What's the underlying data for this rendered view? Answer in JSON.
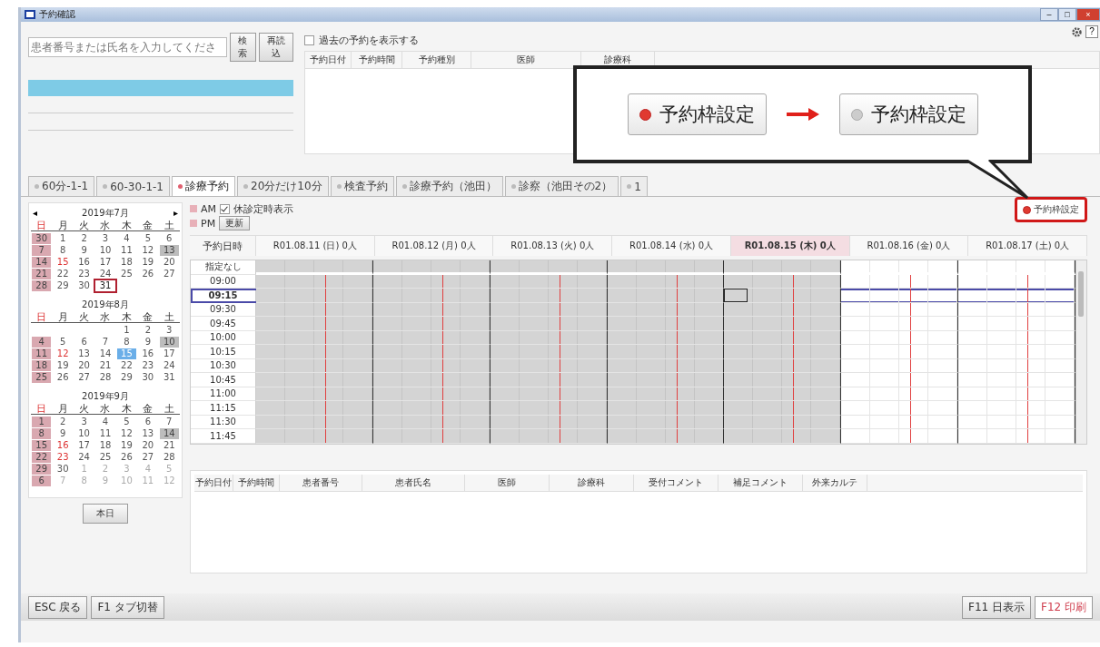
{
  "window": {
    "title": "予約確認",
    "controls": [
      "–",
      "□",
      "×"
    ]
  },
  "top_icons": [
    "?"
  ],
  "search": {
    "placeholder": "患者番号または氏名を入力してくださ",
    "buttons": [
      "検索",
      "再読込"
    ]
  },
  "past_toggle": {
    "label": "過去の予約を表示する",
    "checked": false
  },
  "top_table": {
    "columns": [
      "予約日付",
      "予約時間",
      "予約種別",
      "医師",
      "診療科"
    ]
  },
  "callout": {
    "buttons": [
      {
        "label": "予約枠設定",
        "on": true
      },
      {
        "label": "予約枠設定",
        "on": false
      }
    ]
  },
  "tabs": [
    {
      "label": "60分-1-1",
      "selected": false
    },
    {
      "label": "60-30-1-1",
      "selected": false
    },
    {
      "label": "診療予約",
      "selected": true
    },
    {
      "label": "20分だけ10分",
      "selected": false
    },
    {
      "label": "検査予約",
      "selected": false
    },
    {
      "label": "診療予約（池田）",
      "selected": false
    },
    {
      "label": "診察（池田その2）",
      "selected": false
    },
    {
      "label": "1",
      "selected": false
    }
  ],
  "calendar": {
    "nav": [
      "◂",
      "▸"
    ],
    "button": "本日",
    "months": [
      {
        "title": "2019年7月",
        "weekdays": [
          "日",
          "月",
          "火",
          "水",
          "木",
          "金",
          "土"
        ],
        "weeks": [
          [
            {
              "d": "30",
              "kind": "closed"
            },
            {
              "d": "1",
              "kind": "normal"
            },
            {
              "d": "2",
              "kind": "normal"
            },
            {
              "d": "3",
              "kind": "normal"
            },
            {
              "d": "4",
              "kind": "normal"
            },
            {
              "d": "5",
              "kind": "normal"
            },
            {
              "d": "6",
              "kind": "normal"
            }
          ],
          [
            {
              "d": "7",
              "kind": "closed"
            },
            {
              "d": "8",
              "kind": "normal"
            },
            {
              "d": "9",
              "kind": "normal"
            },
            {
              "d": "10",
              "kind": "normal"
            },
            {
              "d": "11",
              "kind": "normal"
            },
            {
              "d": "12",
              "kind": "normal"
            },
            {
              "d": "13",
              "kind": "grey"
            }
          ],
          [
            {
              "d": "14",
              "kind": "closed"
            },
            {
              "d": "15",
              "kind": "holiday"
            },
            {
              "d": "16",
              "kind": "normal"
            },
            {
              "d": "17",
              "kind": "normal"
            },
            {
              "d": "18",
              "kind": "normal"
            },
            {
              "d": "19",
              "kind": "normal"
            },
            {
              "d": "20",
              "kind": "normal"
            }
          ],
          [
            {
              "d": "21",
              "kind": "closed"
            },
            {
              "d": "22",
              "kind": "normal"
            },
            {
              "d": "23",
              "kind": "normal"
            },
            {
              "d": "24",
              "kind": "normal"
            },
            {
              "d": "25",
              "kind": "normal"
            },
            {
              "d": "26",
              "kind": "normal"
            },
            {
              "d": "27",
              "kind": "normal"
            }
          ],
          [
            {
              "d": "28",
              "kind": "closed"
            },
            {
              "d": "29",
              "kind": "normal"
            },
            {
              "d": "30",
              "kind": "normal"
            },
            {
              "d": "31",
              "kind": "today"
            }
          ]
        ]
      },
      {
        "title": "2019年8月",
        "weekdays": [
          "日",
          "月",
          "火",
          "水",
          "木",
          "金",
          "土"
        ],
        "weeks": [
          [
            {
              "kind": "blank"
            },
            {
              "kind": "blank"
            },
            {
              "kind": "blank"
            },
            {
              "kind": "blank"
            },
            {
              "d": "1",
              "kind": "normal"
            },
            {
              "d": "2",
              "kind": "normal"
            },
            {
              "d": "3",
              "kind": "normal"
            }
          ],
          [
            {
              "d": "4",
              "kind": "closed"
            },
            {
              "d": "5",
              "kind": "normal"
            },
            {
              "d": "6",
              "kind": "normal"
            },
            {
              "d": "7",
              "kind": "normal"
            },
            {
              "d": "8",
              "kind": "normal"
            },
            {
              "d": "9",
              "kind": "normal"
            },
            {
              "d": "10",
              "kind": "grey"
            }
          ],
          [
            {
              "d": "11",
              "kind": "closed"
            },
            {
              "d": "12",
              "kind": "holiday"
            },
            {
              "d": "13",
              "kind": "normal"
            },
            {
              "d": "14",
              "kind": "normal"
            },
            {
              "d": "15",
              "kind": "selected"
            },
            {
              "d": "16",
              "kind": "normal"
            },
            {
              "d": "17",
              "kind": "normal"
            }
          ],
          [
            {
              "d": "18",
              "kind": "closed"
            },
            {
              "d": "19",
              "kind": "normal"
            },
            {
              "d": "20",
              "kind": "normal"
            },
            {
              "d": "21",
              "kind": "normal"
            },
            {
              "d": "22",
              "kind": "normal"
            },
            {
              "d": "23",
              "kind": "normal"
            },
            {
              "d": "24",
              "kind": "normal"
            }
          ],
          [
            {
              "d": "25",
              "kind": "closed"
            },
            {
              "d": "26",
              "kind": "normal"
            },
            {
              "d": "27",
              "kind": "normal"
            },
            {
              "d": "28",
              "kind": "normal"
            },
            {
              "d": "29",
              "kind": "normal"
            },
            {
              "d": "30",
              "kind": "normal"
            },
            {
              "d": "31",
              "kind": "normal"
            }
          ]
        ]
      },
      {
        "title": "2019年9月",
        "weekdays": [
          "日",
          "月",
          "火",
          "水",
          "木",
          "金",
          "土"
        ],
        "weeks": [
          [
            {
              "d": "1",
              "kind": "closed"
            },
            {
              "d": "2",
              "kind": "normal"
            },
            {
              "d": "3",
              "kind": "normal"
            },
            {
              "d": "4",
              "kind": "normal"
            },
            {
              "d": "5",
              "kind": "normal"
            },
            {
              "d": "6",
              "kind": "normal"
            },
            {
              "d": "7",
              "kind": "normal"
            }
          ],
          [
            {
              "d": "8",
              "kind": "closed"
            },
            {
              "d": "9",
              "kind": "normal"
            },
            {
              "d": "10",
              "kind": "normal"
            },
            {
              "d": "11",
              "kind": "normal"
            },
            {
              "d": "12",
              "kind": "normal"
            },
            {
              "d": "13",
              "kind": "normal"
            },
            {
              "d": "14",
              "kind": "grey"
            }
          ],
          [
            {
              "d": "15",
              "kind": "closed"
            },
            {
              "d": "16",
              "kind": "holiday"
            },
            {
              "d": "17",
              "kind": "normal"
            },
            {
              "d": "18",
              "kind": "normal"
            },
            {
              "d": "19",
              "kind": "normal"
            },
            {
              "d": "20",
              "kind": "normal"
            },
            {
              "d": "21",
              "kind": "normal"
            }
          ],
          [
            {
              "d": "22",
              "kind": "closed"
            },
            {
              "d": "23",
              "kind": "holiday"
            },
            {
              "d": "24",
              "kind": "normal"
            },
            {
              "d": "25",
              "kind": "normal"
            },
            {
              "d": "26",
              "kind": "normal"
            },
            {
              "d": "27",
              "kind": "normal"
            },
            {
              "d": "28",
              "kind": "normal"
            }
          ],
          [
            {
              "d": "29",
              "kind": "closed"
            },
            {
              "d": "30",
              "kind": "normal"
            },
            {
              "d": "1",
              "kind": "other"
            },
            {
              "d": "2",
              "kind": "other"
            },
            {
              "d": "3",
              "kind": "other"
            },
            {
              "d": "4",
              "kind": "other"
            },
            {
              "d": "5",
              "kind": "other"
            }
          ],
          [
            {
              "d": "6",
              "kind": "closed"
            },
            {
              "d": "7",
              "kind": "other"
            },
            {
              "d": "8",
              "kind": "other"
            },
            {
              "d": "9",
              "kind": "other"
            },
            {
              "d": "10",
              "kind": "other"
            },
            {
              "d": "11",
              "kind": "other"
            },
            {
              "d": "12",
              "kind": "other"
            }
          ]
        ]
      }
    ]
  },
  "legend": [
    {
      "label": "AM",
      "color": "#e8b0b8"
    },
    {
      "label": "PM",
      "color": "#e8b0b8"
    }
  ],
  "fixed_toggle": {
    "label": "休診定時表示",
    "checked": true
  },
  "refresh_button": "更新",
  "slot_setting_button": {
    "label": "予約枠設定",
    "on": true,
    "highlighted": true
  },
  "schedule": {
    "corner": "予約日時",
    "days": [
      {
        "label": "R01.08.11 (日) 0人",
        "selected": false,
        "closed": true
      },
      {
        "label": "R01.08.12 (月) 0人",
        "selected": false,
        "closed": true
      },
      {
        "label": "R01.08.13 (火) 0人",
        "selected": false,
        "closed": true
      },
      {
        "label": "R01.08.14 (水) 0人",
        "selected": false,
        "closed": true
      },
      {
        "label": "R01.08.15 (木) 0人",
        "selected": true,
        "closed": true
      },
      {
        "label": "R01.08.16 (金) 0人",
        "selected": false,
        "closed": false
      },
      {
        "label": "R01.08.17 (土) 0人",
        "selected": false,
        "closed": false
      }
    ],
    "rows": [
      {
        "time": "指定なし",
        "kind": "untimed",
        "selected": false
      },
      {
        "time": "09:00",
        "kind": "slot",
        "selected": false
      },
      {
        "time": "09:15",
        "kind": "slot",
        "selected": true
      },
      {
        "time": "09:30",
        "kind": "slot",
        "selected": false
      },
      {
        "time": "09:45",
        "kind": "slot",
        "selected": false
      },
      {
        "time": "10:00",
        "kind": "slot",
        "selected": false
      },
      {
        "time": "10:15",
        "kind": "slot",
        "selected": false
      },
      {
        "time": "10:30",
        "kind": "slot",
        "selected": false
      },
      {
        "time": "10:45",
        "kind": "slot",
        "selected": false
      },
      {
        "time": "11:00",
        "kind": "slot",
        "selected": false
      },
      {
        "time": "11:15",
        "kind": "slot",
        "selected": false
      },
      {
        "time": "11:30",
        "kind": "slot",
        "selected": false
      },
      {
        "time": "11:45",
        "kind": "slot",
        "selected": false
      }
    ]
  },
  "bottom_table": {
    "columns": [
      "予約日付",
      "予約時間",
      "患者番号",
      "患者氏名",
      "医師",
      "診療科",
      "受付コメント",
      "補足コメント",
      "外来カルテ"
    ]
  },
  "footer": {
    "left": [
      "ESC 戻る",
      "F1 タブ切替"
    ],
    "right": [
      {
        "label": "F11 日表示",
        "accent": false
      },
      {
        "label": "F12 印刷",
        "accent": true
      }
    ]
  }
}
